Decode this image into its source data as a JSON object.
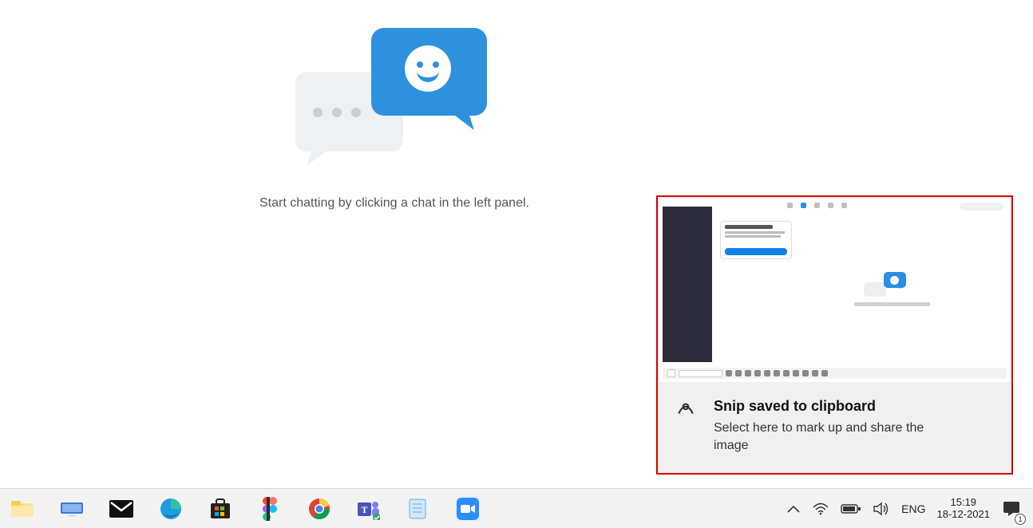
{
  "main": {
    "empty_state_text": "Start chatting by clicking a chat in the left panel."
  },
  "notification": {
    "title": "Snip saved to clipboard",
    "subtitle": "Select here to mark up and share the image"
  },
  "tray": {
    "language": "ENG",
    "time": "15:19",
    "date": "18-12-2021",
    "action_badge": "1"
  }
}
